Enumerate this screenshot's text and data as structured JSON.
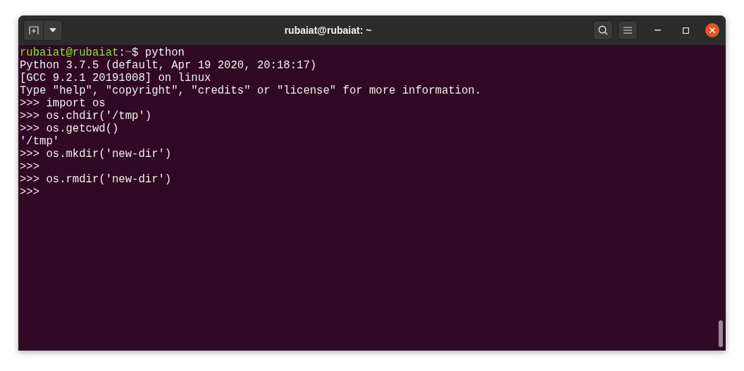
{
  "window": {
    "title": "rubaiat@rubaiat: ~"
  },
  "terminal": {
    "lines": [
      {
        "segments": [
          {
            "kind": "user",
            "text": "rubaiat@rubaiat"
          },
          {
            "kind": "plain",
            "text": ":"
          },
          {
            "kind": "path",
            "text": "~"
          },
          {
            "kind": "plain",
            "text": "$ python"
          }
        ]
      },
      {
        "segments": [
          {
            "kind": "plain",
            "text": "Python 3.7.5 (default, Apr 19 2020, 20:18:17)"
          }
        ]
      },
      {
        "segments": [
          {
            "kind": "plain",
            "text": "[GCC 9.2.1 20191008] on linux"
          }
        ]
      },
      {
        "segments": [
          {
            "kind": "plain",
            "text": "Type \"help\", \"copyright\", \"credits\" or \"license\" for more information."
          }
        ]
      },
      {
        "segments": [
          {
            "kind": "plain",
            "text": ">>> import os"
          }
        ]
      },
      {
        "segments": [
          {
            "kind": "plain",
            "text": ">>> os.chdir('/tmp')"
          }
        ]
      },
      {
        "segments": [
          {
            "kind": "plain",
            "text": ">>> os.getcwd()"
          }
        ]
      },
      {
        "segments": [
          {
            "kind": "plain",
            "text": "'/tmp'"
          }
        ]
      },
      {
        "segments": [
          {
            "kind": "plain",
            "text": ">>> os.mkdir('new-dir')"
          }
        ]
      },
      {
        "segments": [
          {
            "kind": "plain",
            "text": ">>>"
          }
        ]
      },
      {
        "segments": [
          {
            "kind": "plain",
            "text": ">>> os.rmdir('new-dir')"
          }
        ]
      },
      {
        "segments": [
          {
            "kind": "plain",
            "text": ">>>"
          }
        ]
      }
    ]
  }
}
